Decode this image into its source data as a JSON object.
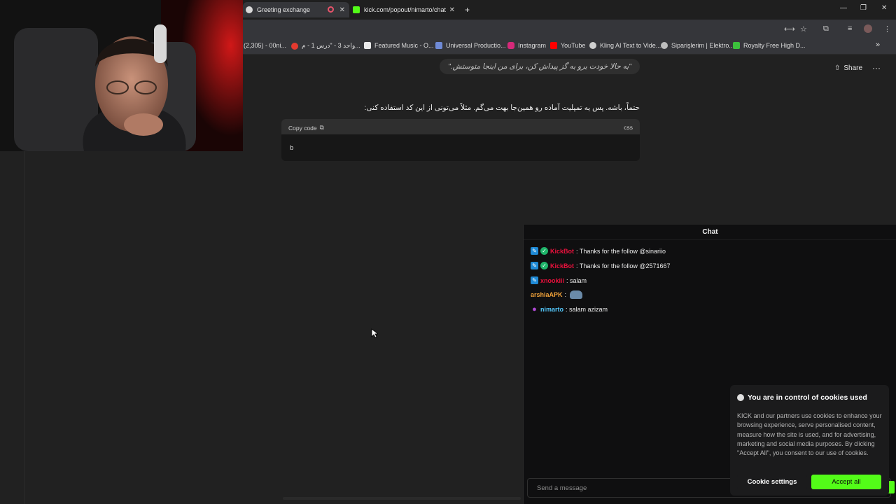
{
  "browser": {
    "tabs": [
      {
        "title": "Greeting exchange",
        "active": true
      },
      {
        "title": "kick.com/popout/nimarto/chat",
        "active": false
      }
    ],
    "new_tab": "+",
    "bookmarks": [
      "‎(2,305) - 00ni...",
      "واحد 3 - \"درس 1 - م...",
      "Featured Music - O...",
      "Universal Productio...",
      "Instagram",
      "YouTube",
      "Kling AI Text to Vide...",
      "Siparişlerim | Elektro...",
      "Royalty Free High D..."
    ],
    "bookmarks_overflow": "»"
  },
  "conversation": {
    "user_prompt": "\"به حالا خودت برو به گز پیداش کن، برای من اینجا متوستش.\"",
    "share_label": "Share",
    "more_label": "···",
    "assistant_reply": "حتماً، باشه. پس یه تمپلیت آماده رو همین‌جا بهت می‌گم. مثلاً می‌تونی از این کد استفاده کنی:",
    "code": {
      "copy_label": "Copy code",
      "language": "css",
      "content": "b"
    }
  },
  "chat": {
    "title": "Chat",
    "messages": [
      {
        "user": "KickBot",
        "text": ": Thanks for the follow @sinariio",
        "user_color": "#e9113c"
      },
      {
        "user": "KickBot",
        "text": ": Thanks for the follow @2571667",
        "user_color": "#e9113c"
      },
      {
        "user": "xnookiii",
        "text": ": salam",
        "user_color": "#e9113c"
      },
      {
        "user": "arshiaAPK",
        "text": ":",
        "user_color": "#f2a33a"
      },
      {
        "user": "nimarto",
        "text": ": salam azizam",
        "user_color": "#53c8fc"
      }
    ],
    "input_placeholder": "Send a message"
  },
  "cookie_popup": {
    "title": "You are in control of cookies used",
    "body": "KICK and our partners use cookies to enhance your browsing experience, serve personalised content, measure how the site is used, and for advertising, marketing and social media purposes. By clicking \"Accept All\", you consent to our use of cookies.",
    "settings_label": "Cookie settings",
    "accept_label": "Accept all"
  },
  "colors": {
    "kick_green": "#53fc18",
    "page_bg": "#212121",
    "chat_bg": "#0f0f10"
  }
}
